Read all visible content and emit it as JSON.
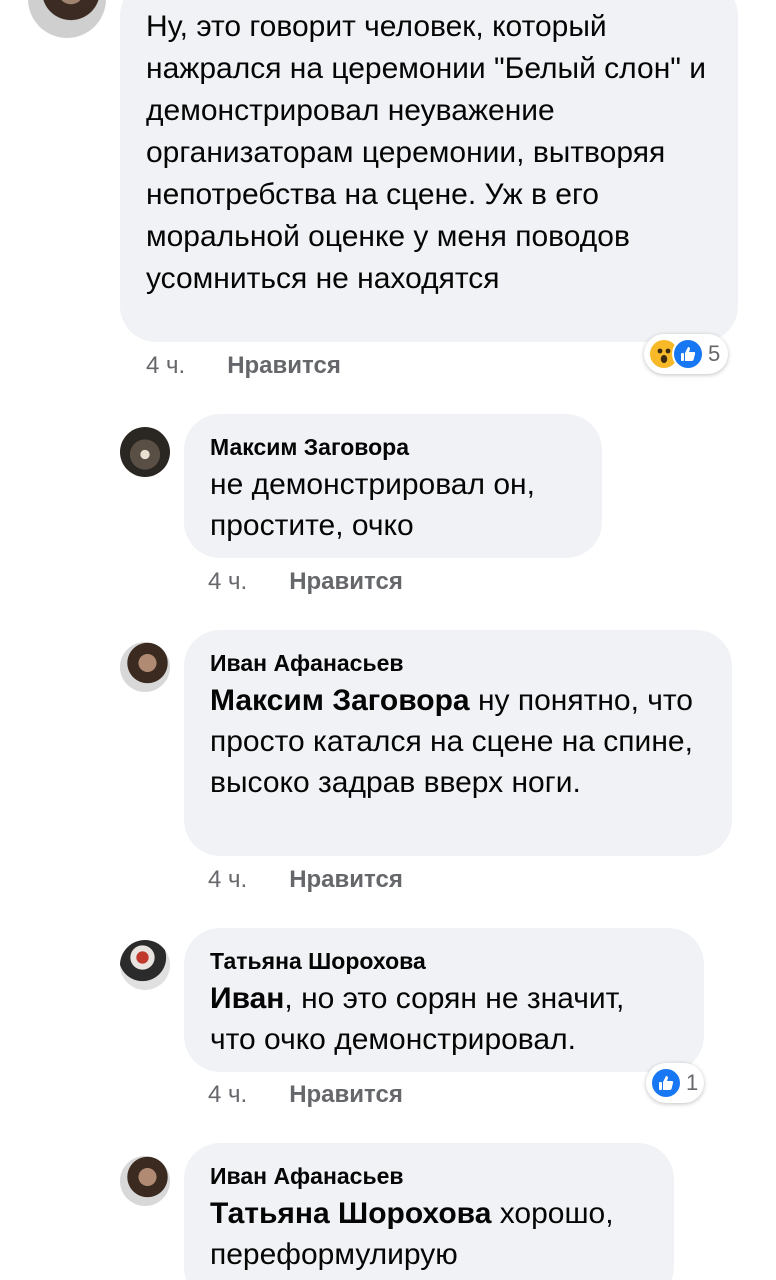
{
  "comments": [
    {
      "author": "",
      "segments": [
        {
          "text": "Ну, это говорит человек, который нажрался на церемонии \"Белый слон\" и демонстрировал неуважение организаторам церемонии, вытворяя непотребства на сцене. Уж в его моральной оценке у меня поводов усомниться не находятся",
          "bold": false
        }
      ],
      "time": "4 ч.",
      "like_label": "Нравится",
      "reactions": {
        "icons": [
          "wow-icon",
          "like-icon"
        ],
        "count": "5"
      }
    },
    {
      "author": "Максим Заговора",
      "text": "не демонстрировал он, простите, очко",
      "time": "4 ч.",
      "like_label": "Нравится"
    },
    {
      "author": "Иван Афанасьев",
      "mention": "Максим Заговора",
      "text": " ну понятно, что просто катался на сцене на спине, высоко задрав вверх ноги.",
      "time": "4 ч.",
      "like_label": "Нравится"
    },
    {
      "author": "Татьяна Шорохова",
      "mention": "Иван",
      "text": ", но это сорян не значит, что очко демонстрировал.",
      "time": "4 ч.",
      "like_label": "Нравится",
      "reactions": {
        "icons": [
          "like-icon"
        ],
        "count": "1"
      }
    },
    {
      "author": "Иван Афанасьев",
      "mention": "Татьяна Шорохова",
      "text": " хорошо, переформулирую"
    }
  ],
  "colors": {
    "bubble": "#f0f2f5",
    "meta": "#65676b",
    "like_blue": "#1877f2",
    "wow_yellow": "#f7b928"
  }
}
